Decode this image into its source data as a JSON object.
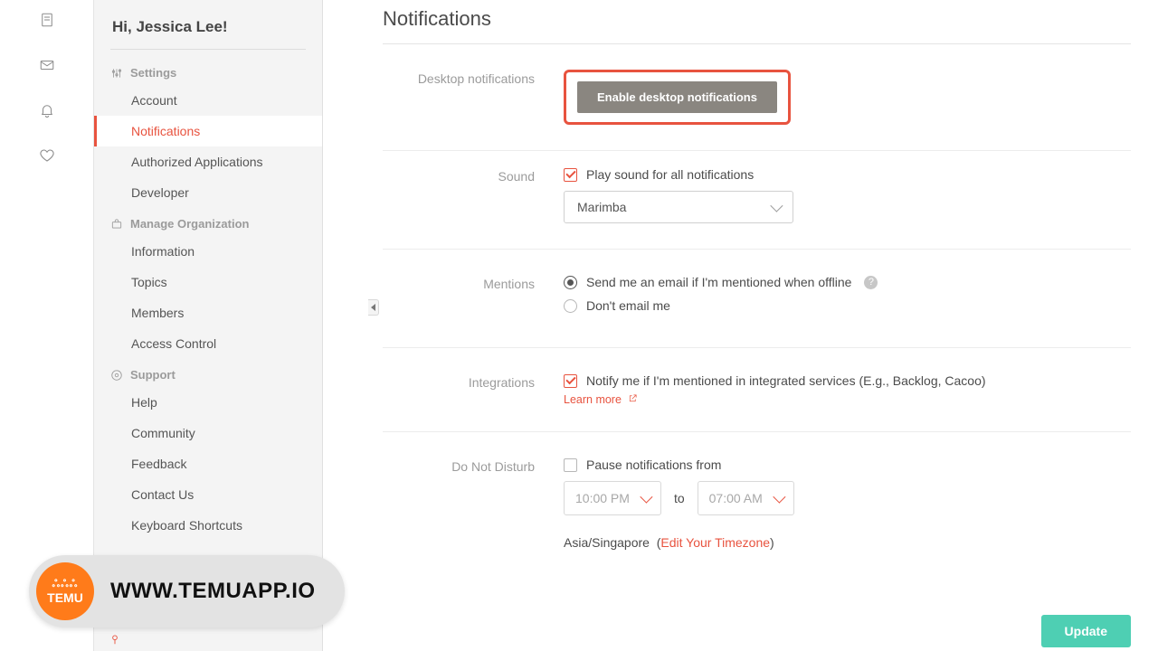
{
  "greeting": "Hi, Jessica Lee!",
  "page_title": "Notifications",
  "sidebar": {
    "sections": {
      "settings": {
        "label": "Settings",
        "items": [
          "Account",
          "Notifications",
          "Authorized Applications",
          "Developer"
        ],
        "active_index": 1
      },
      "org": {
        "label": "Manage Organization",
        "items": [
          "Information",
          "Topics",
          "Members",
          "Access Control"
        ]
      },
      "support": {
        "label": "Support",
        "items": [
          "Help",
          "Community",
          "Feedback",
          "Contact Us",
          "Keyboard Shortcuts"
        ]
      }
    }
  },
  "rows": {
    "desktop": {
      "label": "Desktop notifications",
      "button": "Enable desktop notifications"
    },
    "sound": {
      "label": "Sound",
      "checkbox": "Play sound for all notifications",
      "select_value": "Marimba"
    },
    "mentions": {
      "label": "Mentions",
      "opt_email": "Send me an email if I'm mentioned when offline",
      "opt_none": "Don't email me"
    },
    "integrations": {
      "label": "Integrations",
      "checkbox": "Notify me if I'm mentioned in integrated services (E.g., Backlog, Cacoo)",
      "learn_more": "Learn more"
    },
    "dnd": {
      "label": "Do Not Disturb",
      "checkbox": "Pause notifications from",
      "from_time": "10:00 PM",
      "to_label": "to",
      "to_time": "07:00 AM",
      "timezone": "Asia/Singapore",
      "edit_tz": "Edit Your Timezone"
    }
  },
  "update_button": "Update",
  "watermark": {
    "badge_top": "ஃஃஃ",
    "badge_text": "TEMU",
    "url": "WWW.TEMUAPP.IO"
  }
}
